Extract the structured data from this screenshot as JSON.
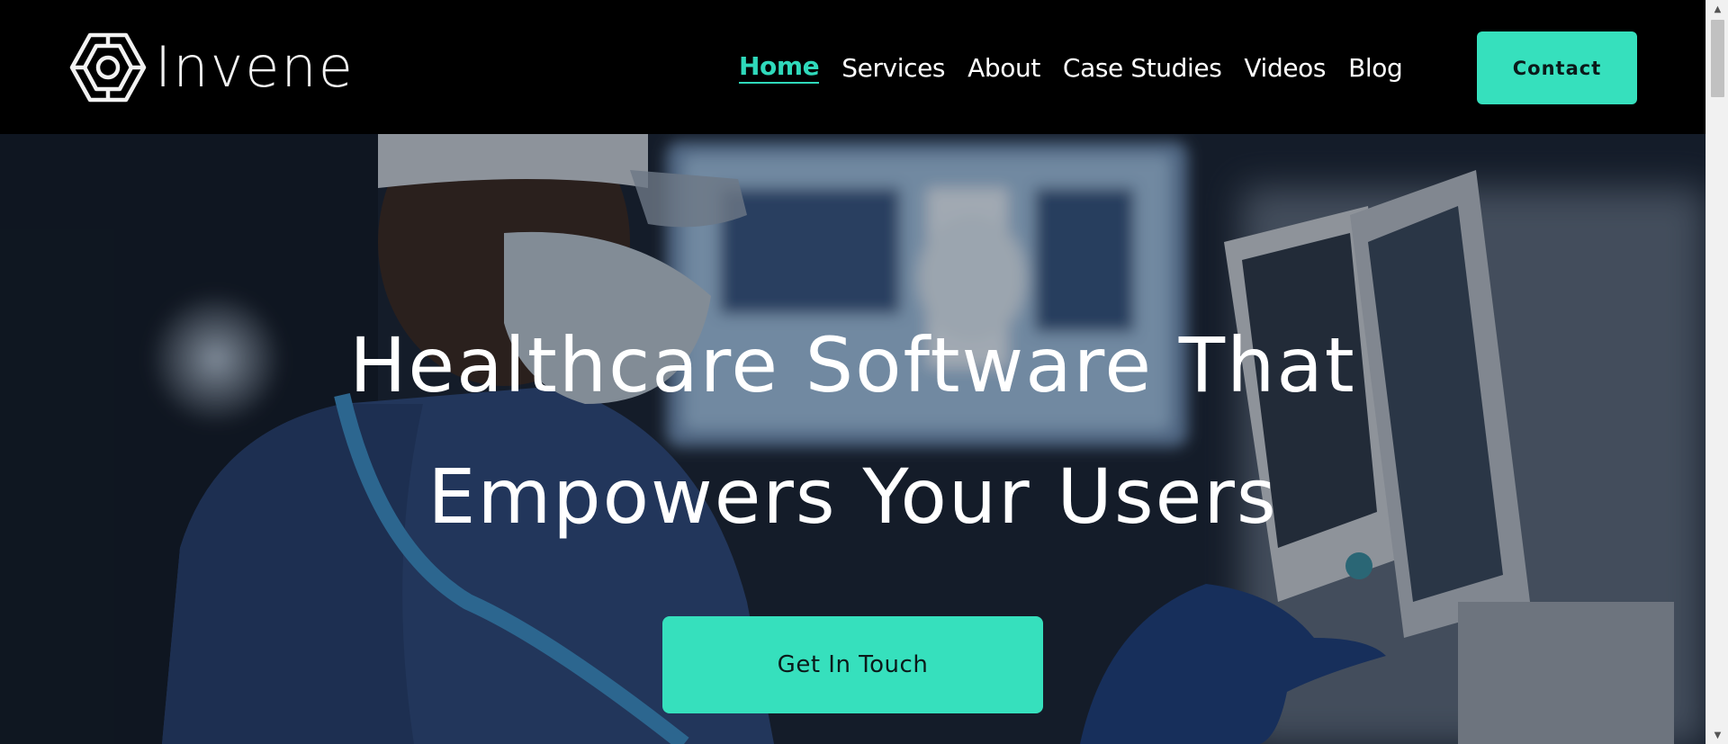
{
  "brand": {
    "name": "Invene",
    "logo_icon": "hexagon-maze-icon"
  },
  "nav": {
    "items": [
      {
        "label": "Home",
        "active": true
      },
      {
        "label": "Services",
        "active": false
      },
      {
        "label": "About",
        "active": false
      },
      {
        "label": "Case Studies",
        "active": false
      },
      {
        "label": "Videos",
        "active": false
      },
      {
        "label": "Blog",
        "active": false
      }
    ],
    "contact_label": "Contact"
  },
  "hero": {
    "title_line1": "Healthcare Software That",
    "title_line2": "Empowers Your Users",
    "cta_label": "Get In Touch",
    "background_image": "surgeon-monitor-photo"
  },
  "colors": {
    "accent": "#36e0bd",
    "nav_active": "#2fd9bb",
    "header_bg": "#000000",
    "text": "#ffffff"
  },
  "scrollbar": {
    "up_icon": "scroll-up-arrow-icon",
    "down_icon": "scroll-down-arrow-icon"
  }
}
